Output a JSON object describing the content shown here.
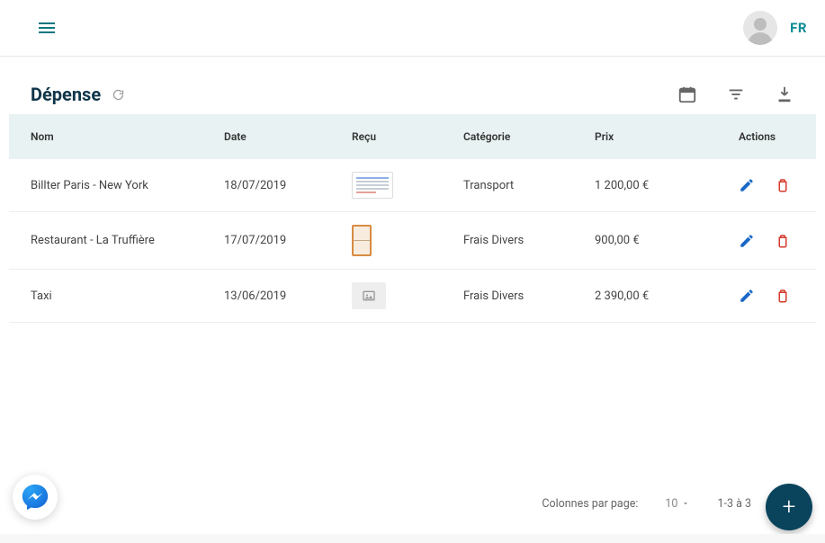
{
  "topbar": {
    "language": "FR"
  },
  "page": {
    "title": "Dépense"
  },
  "table": {
    "headers": {
      "name": "Nom",
      "date": "Date",
      "receipt": "Reçu",
      "category": "Catégorie",
      "price": "Prix",
      "actions": "Actions"
    },
    "rows": [
      {
        "name": "Billter Paris - New York",
        "date": "18/07/2019",
        "receipt_type": "wide",
        "category": "Transport",
        "price": "1 200,00 €"
      },
      {
        "name": "Restaurant - La Truffière",
        "date": "17/07/2019",
        "receipt_type": "tall",
        "category": "Frais Divers",
        "price": "900,00 €"
      },
      {
        "name": "Taxi",
        "date": "13/06/2019",
        "receipt_type": "empty",
        "category": "Frais Divers",
        "price": "2 390,00 €"
      }
    ]
  },
  "pagination": {
    "label": "Colonnes par page:",
    "per_page": "10",
    "range": "1-3 à 3"
  },
  "fab": {
    "label": "+"
  }
}
